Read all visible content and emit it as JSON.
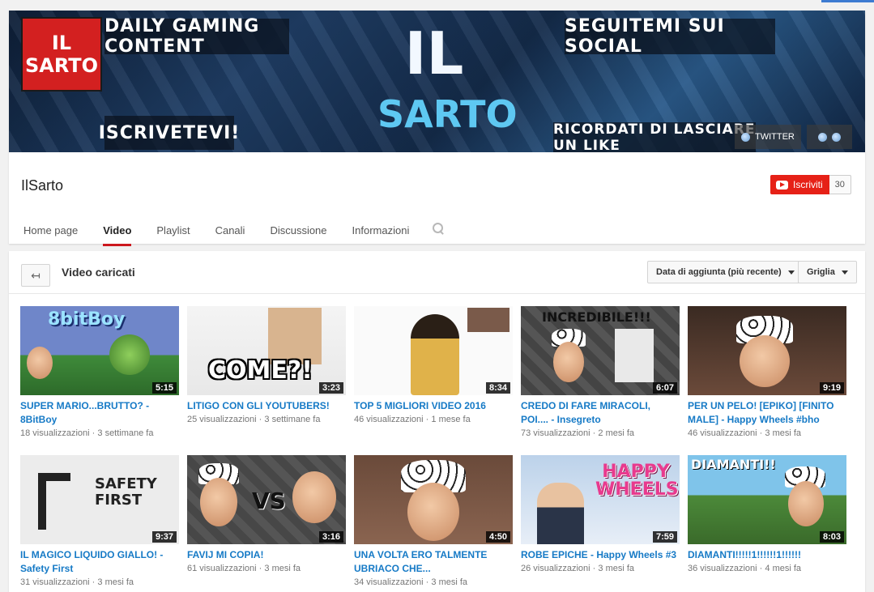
{
  "banner": {
    "logo_line1": "IL",
    "logo_line2": "SARTO",
    "tagline_top_left": "DAILY GAMING CONTENT",
    "tagline_top_right": "SEGUITEMI SUI SOCIAL",
    "tagline_bottom_left": "ISCRIVETEVI!",
    "tagline_bottom_right": "RICORDATI DI LASCIARE UN LIKE",
    "title_line1": "IL",
    "title_line2": "SARTO",
    "twitter_label": "TWITTER"
  },
  "channel": {
    "name": "IlSarto",
    "subscribe_label": "Iscriviti",
    "subscriber_count": "30"
  },
  "tabs": [
    {
      "label": "Home page",
      "active": false
    },
    {
      "label": "Video",
      "active": true
    },
    {
      "label": "Playlist",
      "active": false
    },
    {
      "label": "Canali",
      "active": false
    },
    {
      "label": "Discussione",
      "active": false
    },
    {
      "label": "Informazioni",
      "active": false
    }
  ],
  "section": {
    "title": "Video caricati",
    "sort_label": "Data di aggiunta (più recente)",
    "view_label": "Griglia"
  },
  "videos": [
    {
      "title": "SUPER MARIO...BRUTTO? - 8BitBoy",
      "views": "18 visualizzazioni",
      "age": "3 settimane fa",
      "duration": "5:15",
      "thumb_text": "8bitBoy"
    },
    {
      "title": "LITIGO CON GLI YOUTUBERS!",
      "views": "25 visualizzazioni",
      "age": "3 settimane fa",
      "duration": "3:23",
      "thumb_text": "COME?!"
    },
    {
      "title": "TOP 5 MIGLIORI VIDEO 2016",
      "views": "46 visualizzazioni",
      "age": "1 mese fa",
      "duration": "8:34",
      "thumb_text": ""
    },
    {
      "title": "CREDO DI FARE MIRACOLI, POI.... - Insegreto",
      "views": "73 visualizzazioni",
      "age": "2 mesi fa",
      "duration": "6:07",
      "thumb_text": "INCREDIBILE!!!"
    },
    {
      "title": "PER UN PELO! [EPIKO] [FINITO MALE] - Happy Wheels #bho",
      "views": "46 visualizzazioni",
      "age": "3 mesi fa",
      "duration": "9:19",
      "thumb_text": ""
    },
    {
      "title": "IL MAGICO LIQUIDO GIALLO! - Safety First",
      "views": "31 visualizzazioni",
      "age": "3 mesi fa",
      "duration": "9:37",
      "thumb_text": "SAFETY FIRST"
    },
    {
      "title": "FAVIJ MI COPIA!",
      "views": "61 visualizzazioni",
      "age": "3 mesi fa",
      "duration": "3:16",
      "thumb_text": "VS"
    },
    {
      "title": "UNA VOLTA ERO TALMENTE UBRIACO CHE...",
      "views": "34 visualizzazioni",
      "age": "3 mesi fa",
      "duration": "4:50",
      "thumb_text": ""
    },
    {
      "title": "ROBE EPICHE - Happy Wheels #3",
      "views": "26 visualizzazioni",
      "age": "3 mesi fa",
      "duration": "7:59",
      "thumb_text": "HAPPY WHEELS"
    },
    {
      "title": "DIAMANTI!!!!!1!!!!!!1!!!!!!",
      "views": "36 visualizzazioni",
      "age": "4 mesi fa",
      "duration": "8:03",
      "thumb_text": "DIAMANTI!!"
    }
  ]
}
